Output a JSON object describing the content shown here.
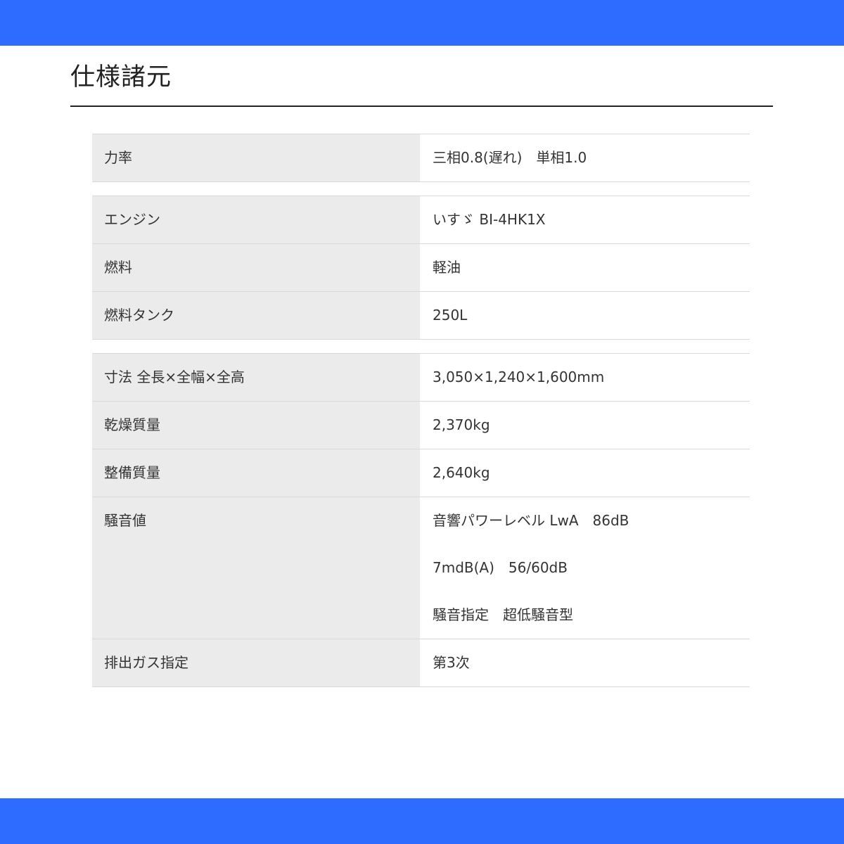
{
  "header": {
    "title": "仕様諸元"
  },
  "colors": {
    "bar": "#2e6bff",
    "label_bg": "#ebebeb",
    "border": "#d8d8d8"
  },
  "tables": [
    {
      "rows": [
        {
          "label": "力率",
          "value": "三相0.8(遅れ)　単相1.0"
        }
      ]
    },
    {
      "rows": [
        {
          "label": "エンジン",
          "value": "いすゞ BI-4HK1X"
        },
        {
          "label": "燃料",
          "value": "軽油"
        },
        {
          "label": "燃料タンク",
          "value": "250L"
        }
      ]
    },
    {
      "rows": [
        {
          "label": "寸法 全長×全幅×全高",
          "value": "3,050×1,240×1,600mm"
        },
        {
          "label": "乾燥質量",
          "value": "2,370kg"
        },
        {
          "label": "整備質量",
          "value": "2,640kg"
        },
        {
          "label": "騒音値",
          "values": [
            "音響パワーレベル LwA　86dB",
            "7mdB(A)　56/60dB",
            "騒音指定　超低騒音型"
          ]
        },
        {
          "label": "排出ガス指定",
          "value": "第3次"
        }
      ]
    }
  ]
}
